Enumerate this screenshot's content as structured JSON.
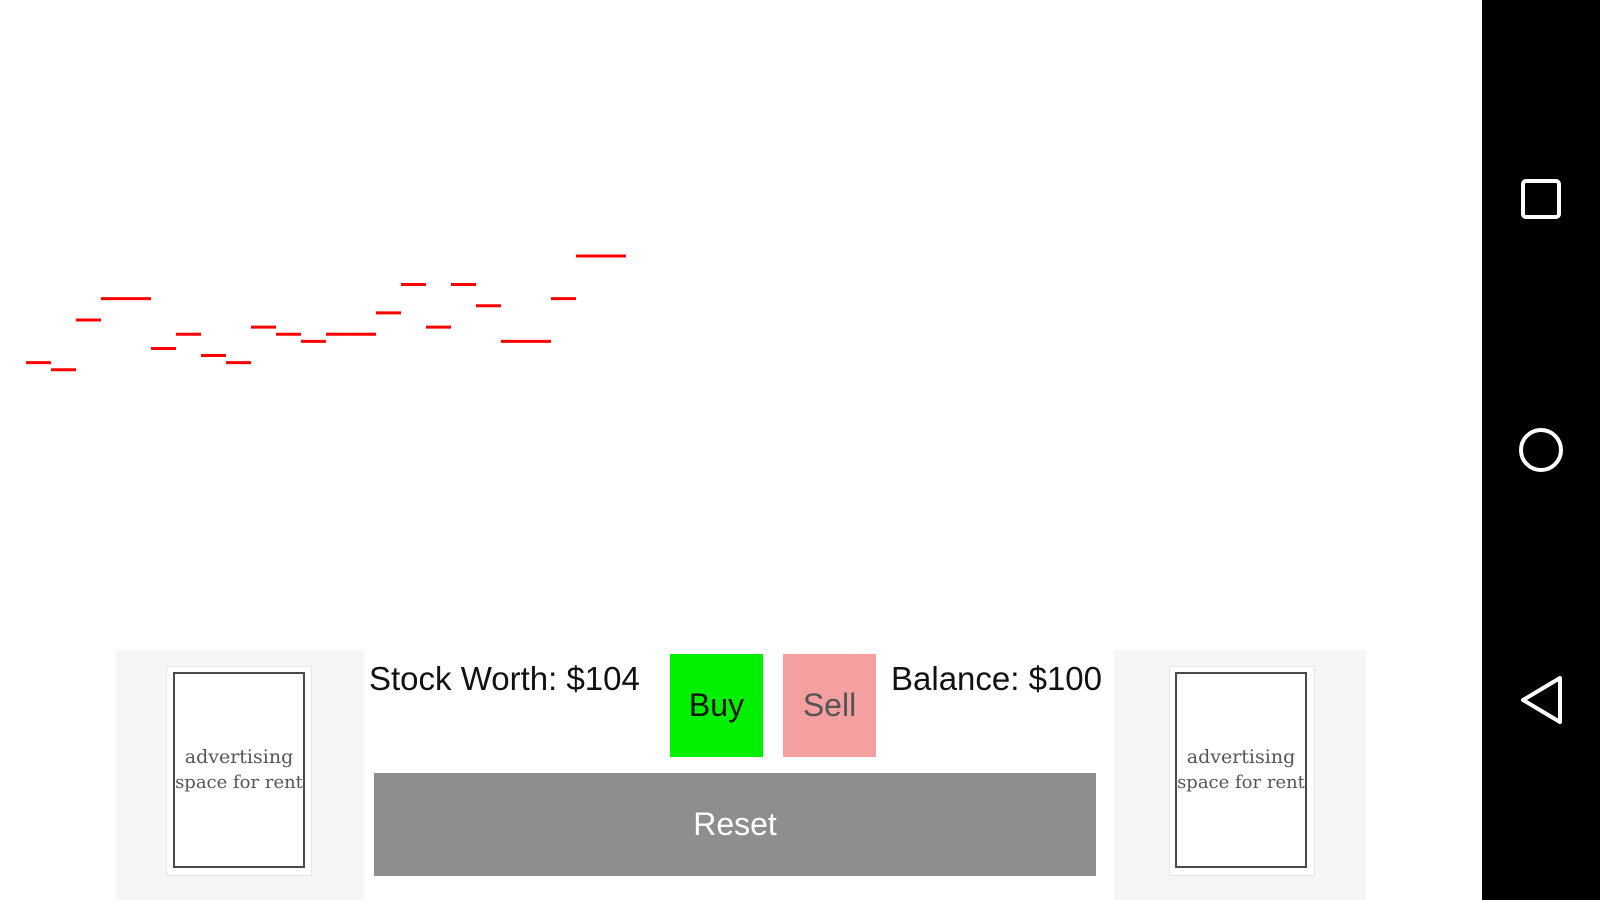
{
  "chart_data": {
    "type": "line",
    "style": "horizontal step segments",
    "color": "#ff0000",
    "x": [
      1,
      2,
      3,
      4,
      5,
      6,
      7,
      8,
      9,
      10,
      11,
      12,
      13,
      14,
      15,
      16,
      17,
      18,
      19,
      20,
      21,
      22,
      23,
      24
    ],
    "values": [
      89,
      88,
      95,
      98,
      98,
      91,
      93,
      90,
      89,
      94,
      93,
      92,
      93,
      93,
      96,
      100,
      94,
      100,
      97,
      92,
      92,
      98,
      104,
      104
    ],
    "xlim": [
      0,
      60
    ],
    "ylim": [
      50,
      140
    ],
    "grid": false
  },
  "controls": {
    "stock_worth": "Stock Worth: $104",
    "buy": "Buy",
    "sell": "Sell",
    "balance": "Balance: $100",
    "reset": "Reset"
  },
  "ads": {
    "left": {
      "line1": "advertising",
      "line2": "space for rent"
    },
    "right": {
      "line1": "advertising",
      "line2": "space for rent"
    }
  },
  "navbar": {
    "icons": [
      "recents-square-icon",
      "home-circle-icon",
      "back-triangle-icon"
    ]
  }
}
